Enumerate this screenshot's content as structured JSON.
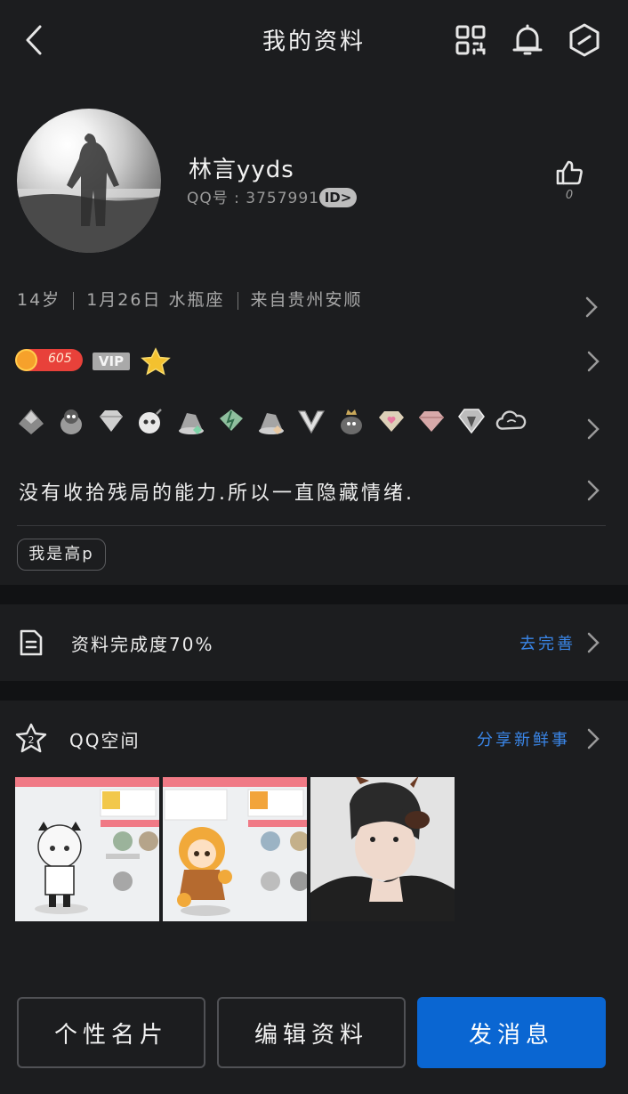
{
  "header": {
    "title": "我的资料"
  },
  "profile": {
    "nickname": "林言yyds",
    "qq_line": "QQ号 : 3757991592",
    "id_badge": "ID>",
    "like_count": "0",
    "info": {
      "age": "14岁",
      "birthday": "1月26日 水瓶座",
      "hometown": "来自贵州安顺"
    },
    "coin_value": "605",
    "vip_label": "VIP",
    "badges": [
      "crown-badge-icon",
      "penguin-badge-icon",
      "diamond-badge-icon",
      "bomb-badge-icon",
      "hat-badge-icon",
      "green-diamond-badge-icon",
      "hat-badge-icon",
      "v-badge-icon",
      "crowned-penguin-badge-icon",
      "heart-diamond-badge-icon",
      "pink-diamond-badge-icon",
      "silver-diamond-badge-icon",
      "cloud-badge-icon"
    ],
    "signature": "没有收拾残局的能力.所以一直隐藏情绪.",
    "tag": "我是高p"
  },
  "completion": {
    "label": "资料完成度70%",
    "link": "去完善"
  },
  "qzone": {
    "label": "QQ空间",
    "link": "分享新鲜事",
    "photos": [
      "qzone-photo-1",
      "qzone-photo-2",
      "qzone-photo-3"
    ]
  },
  "buttons": {
    "card": "个性名片",
    "edit": "编辑资料",
    "message": "发消息"
  },
  "colors": {
    "background": "#1c1d1f",
    "accent": "#0a66d2",
    "link": "#3a86e8",
    "coin": "#e8413a"
  }
}
